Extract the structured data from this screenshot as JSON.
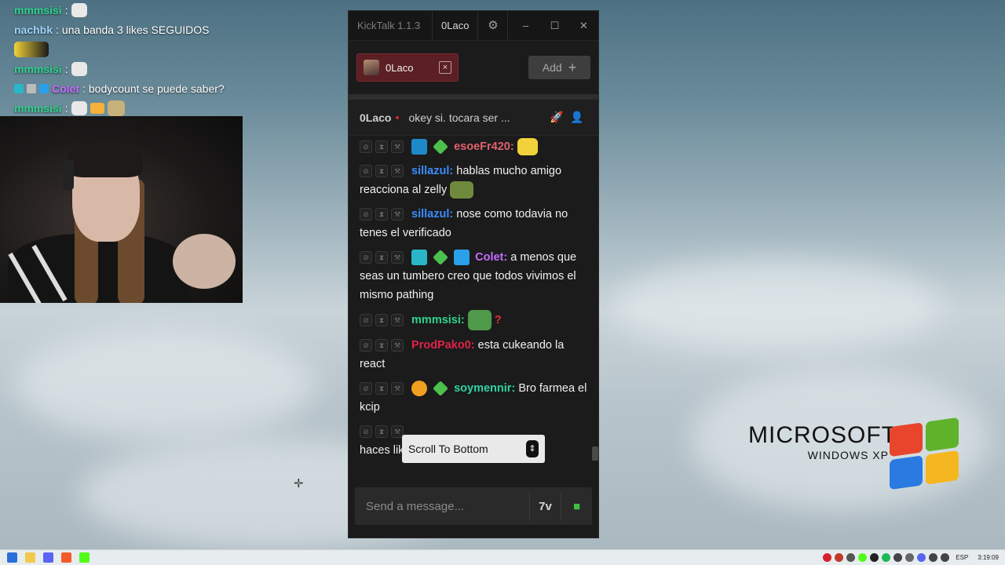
{
  "overlay_chat": [
    {
      "user": "mmmsisi",
      "user_color": "#2fd38c",
      "text": "",
      "emotes": [
        "face"
      ]
    },
    {
      "user": "nachbk",
      "user_color": "#9fd3ff",
      "text": "una banda 3 likes SEGUIDOS",
      "emotes": []
    },
    {
      "user": "",
      "user_color": "#ffffff",
      "text": "",
      "emotes": [
        "wide"
      ]
    },
    {
      "user": "mmmsisi",
      "user_color": "#2fd38c",
      "text": "",
      "emotes": [
        "face"
      ]
    },
    {
      "user": "Colet",
      "user_color": "#c86cff",
      "text": "bodycount se puede saber?",
      "emotes": [],
      "badges": true
    },
    {
      "user": "mmmsisi",
      "user_color": "#2fd38c",
      "text": "",
      "emotes": [
        "face",
        "hand",
        "face2"
      ]
    }
  ],
  "window": {
    "app_name": "KickTalk 1.1.3",
    "user_tab": "0Laco",
    "icons": {
      "settings": "gear-icon",
      "minimize": "minimize-icon",
      "maximize": "maximize-icon",
      "close": "close-icon"
    }
  },
  "channel_tabs": [
    {
      "name": "0Laco",
      "close": "×"
    }
  ],
  "add_button": {
    "label": "Add",
    "icon": "+"
  },
  "channel_header": {
    "user": "0Laco",
    "title": "okey si. tocara ser ..."
  },
  "messages": [
    {
      "user": "esoeFr420",
      "color": "#e0606e",
      "text": "",
      "badges": [
        "#1e88c8",
        "#4cc04c"
      ],
      "emote": "yellow-glasses"
    },
    {
      "user": "sillazul",
      "color": "#3b8cff",
      "text": "hablas mucho amigo reacciona al zelly",
      "badges": [],
      "emote": "frog"
    },
    {
      "user": "sillazul",
      "color": "#3b8cff",
      "text": "nose como todavia no tenes el verificado",
      "badges": [],
      "emote": ""
    },
    {
      "user": "Colet",
      "color": "#c86cff",
      "text": "a menos que seas un tumbero creo que todos vivimos el mismo pathing",
      "badges": [
        "#29b6c8",
        "#4cc04c",
        "#2aa0e8"
      ],
      "emote": ""
    },
    {
      "user": "mmmsisi",
      "color": "#2fd38c",
      "text": "",
      "badges": [],
      "emote": "pepe"
    },
    {
      "user": "ProdPako0",
      "color": "#e0224a",
      "text": "esta cukeando la react",
      "badges": [],
      "emote": ""
    },
    {
      "user": "soymennir",
      "color": "#2fd3a0",
      "text": "Bro farmea el kcip",
      "badges": [
        "#f0a020",
        "#4cc04c"
      ],
      "emote": ""
    },
    {
      "user": "",
      "color": "#ffffff",
      "text": "haces likeaste como 20",
      "badges": [],
      "emote": ""
    }
  ],
  "scroll_to_bottom": {
    "label": "Scroll To Bottom"
  },
  "input": {
    "placeholder": "Send a message..."
  },
  "xp_logo": {
    "brand": "MICROSOFT",
    "product": "WINDOWS XP"
  },
  "taskbar": {
    "language": "ESP",
    "time": "3:19:09"
  }
}
